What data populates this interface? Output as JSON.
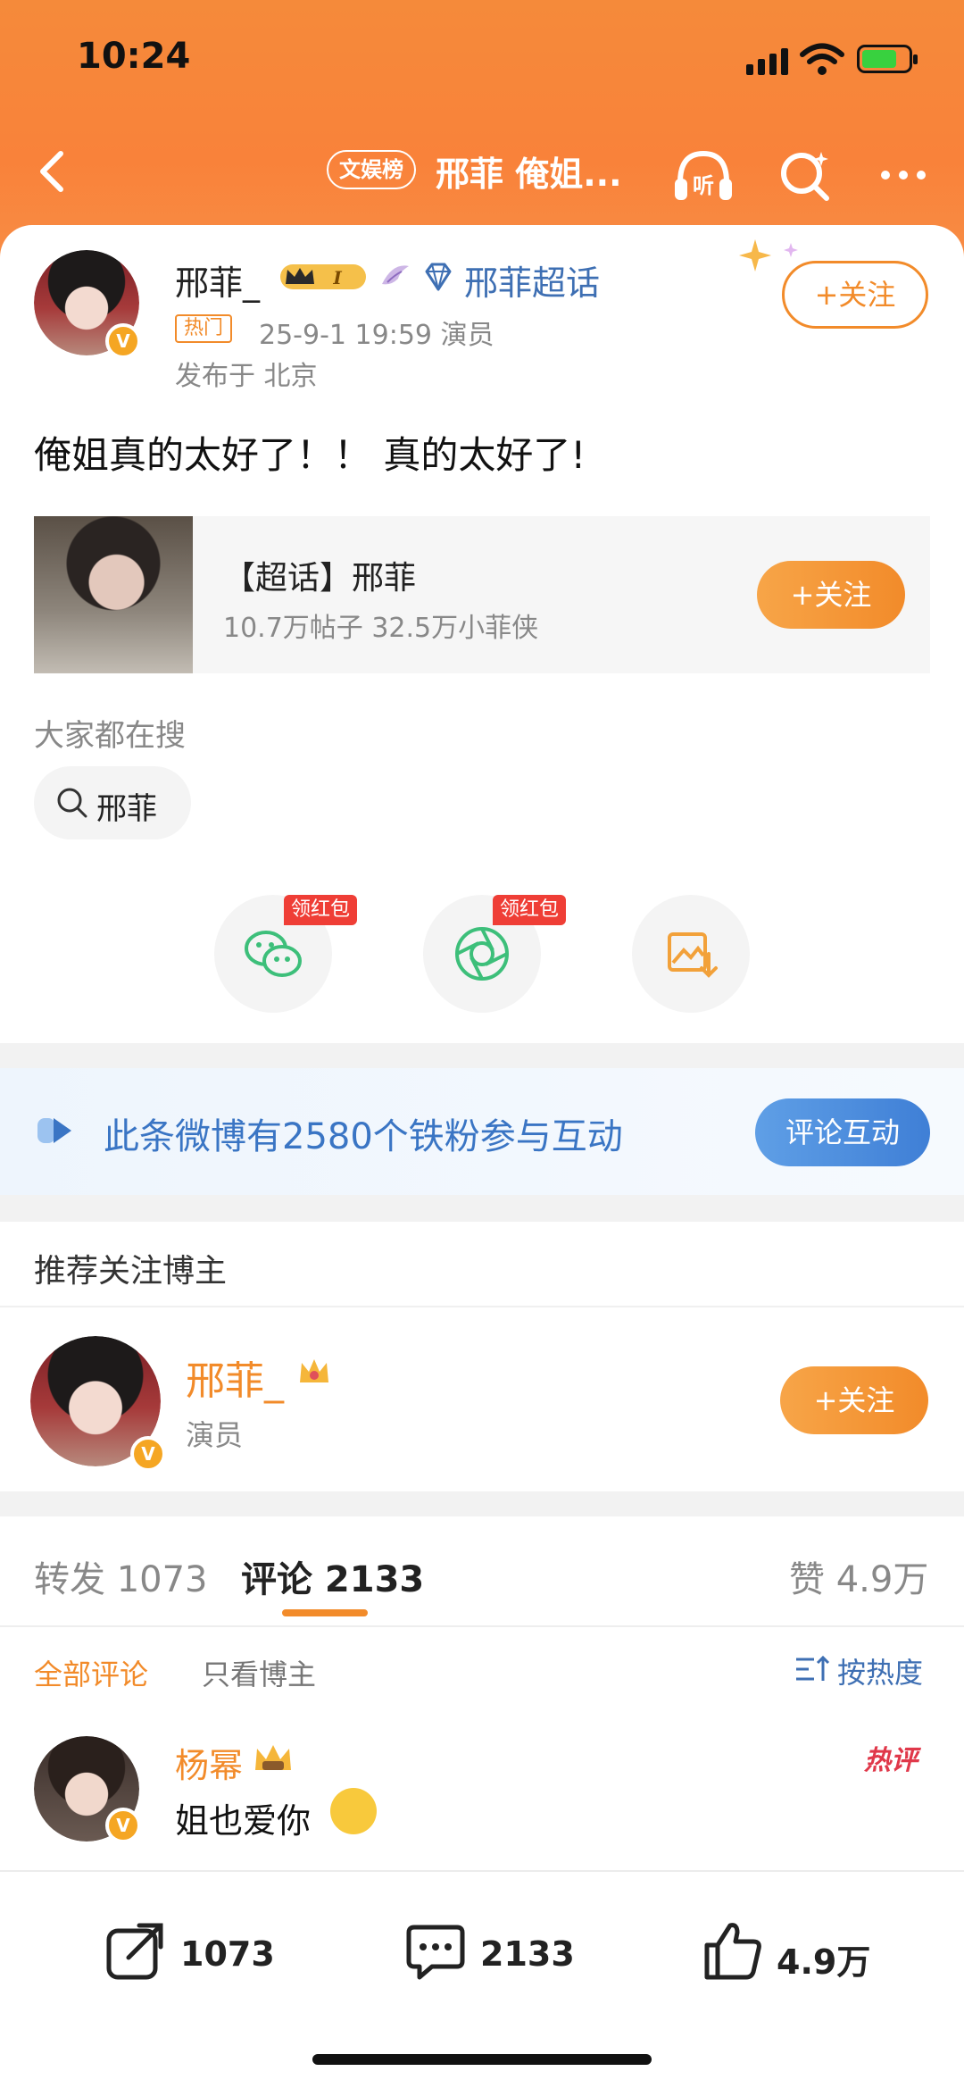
{
  "status_bar": {
    "time": "10:24"
  },
  "header": {
    "tag": "文娱榜",
    "title": "邢菲 俺姐..."
  },
  "post": {
    "author": "邢菲_",
    "verified_mark": "V",
    "super_topic_link": "邢菲超话",
    "hot_tag": "热门",
    "meta": "25-9-1 19:59  演员",
    "location": "发布于 北京",
    "follow_label": "+关注",
    "text": "俺姐真的太好了！！ 真的太好了!"
  },
  "topic_card": {
    "name": "【超话】邢菲",
    "stats": "10.7万帖子  32.5万小菲侠",
    "follow_label": "+关注"
  },
  "search": {
    "label": "大家都在搜",
    "chip": "邢菲"
  },
  "share_row": {
    "badge_1": "领红包",
    "badge_2": "领红包",
    "icons": [
      "wechat-icon",
      "moments-icon",
      "save-image-icon"
    ]
  },
  "fan_bar": {
    "text": "此条微博有2580个铁粉参与互动",
    "button": "评论互动"
  },
  "recommend": {
    "title": "推荐关注博主",
    "name": "邢菲_",
    "subtitle": "演员",
    "follow_label": "+关注"
  },
  "comment_tabs": {
    "repost": "转发 1073",
    "comment": "评论 2133",
    "like": "赞 4.9万"
  },
  "comment_filters": {
    "all": "全部评论",
    "author_only": "只看博主",
    "sort": "按热度"
  },
  "comments": [
    {
      "name": "杨幂",
      "text": "姐也爱你",
      "badge": "热评"
    }
  ],
  "bottom_bar": {
    "repost": "1073",
    "comment": "2133",
    "like": "4.9万"
  },
  "colors": {
    "accent": "#f28b2a",
    "link": "#3e6fb3",
    "header_bg": "#f58a3a",
    "interaction_blue": "#3a75c4"
  }
}
